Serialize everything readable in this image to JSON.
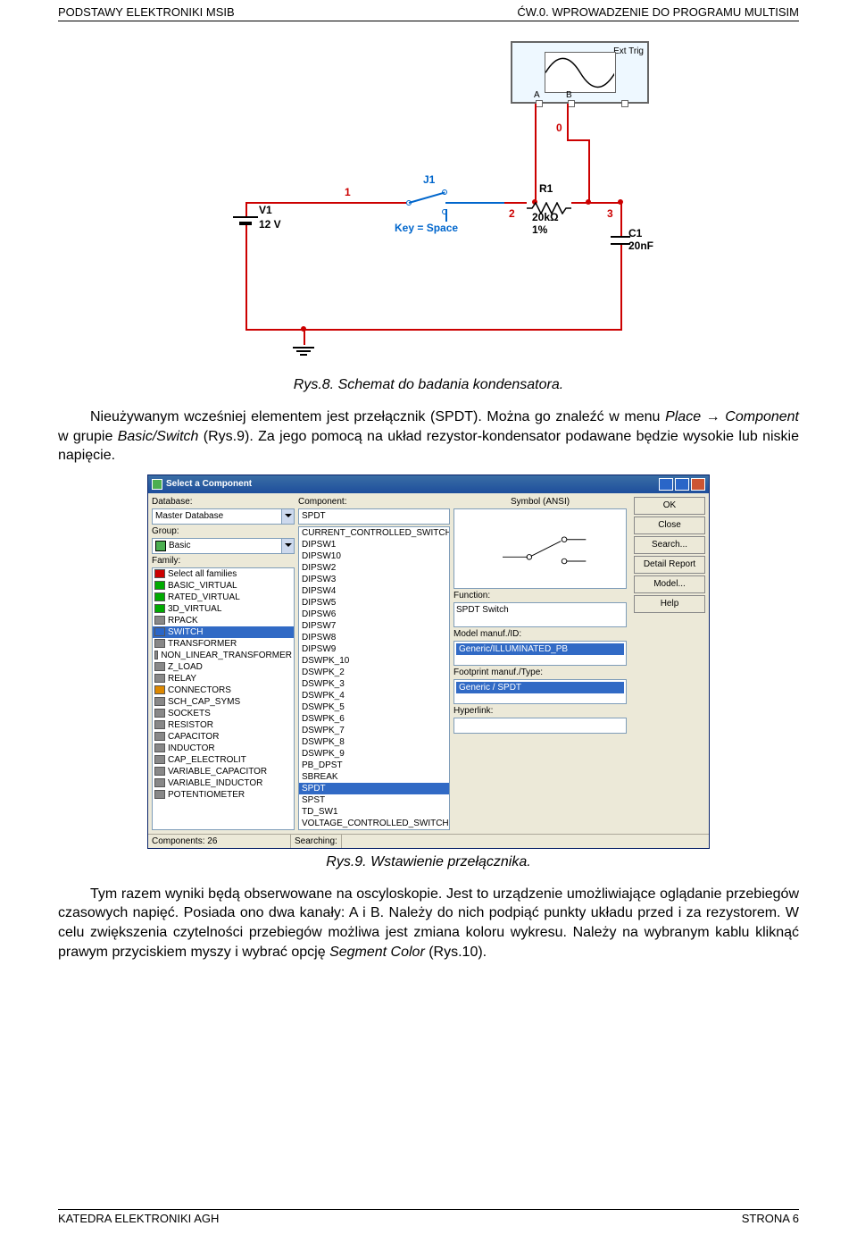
{
  "header": {
    "left": "PODSTAWY ELEKTRONIKI MSIB",
    "right": "ĆW.0. WPROWADZENIE DO PROGRAMU MULTISIM"
  },
  "footer": {
    "left": "KATEDRA ELEKTRONIKI AGH",
    "right": "STRONA 6"
  },
  "schematic": {
    "v1_name": "V1",
    "v1_val": "12 V",
    "j1": "J1",
    "key": "Key = Space",
    "r1_name": "R1",
    "r1_val": "20kΩ",
    "r1_tol": "1%",
    "c1_name": "C1",
    "c1_val": "20nF",
    "net1": "1",
    "net2": "2",
    "net3": "3",
    "net0": "0",
    "scope_A": "A",
    "scope_B": "B",
    "scope_trig": "Ext Trig"
  },
  "caption1": "Rys.8. Schemat do badania kondensatora.",
  "para1_a": "Nieużywanym wcześniej elementem jest przełącznik (SPDT). Można go znaleźć w menu ",
  "para1_i1": "Place → Component",
  "para1_b": " w grupie ",
  "para1_i2": "Basic/Switch",
  "para1_c": " (Rys.9). Za jego pomocą na układ rezystor-kondensator podawane będzie wysokie lub niskie napięcie.",
  "dlg": {
    "title": "Select a Component",
    "database_lbl": "Database:",
    "database_val": "Master Database",
    "group_lbl": "Group:",
    "group_val": "Basic",
    "family_lbl": "Family:",
    "families": [
      {
        "t": "Select all families",
        "c": "red"
      },
      {
        "t": "BASIC_VIRTUAL",
        "c": "green"
      },
      {
        "t": "RATED_VIRTUAL",
        "c": "green"
      },
      {
        "t": "3D_VIRTUAL",
        "c": "green"
      },
      {
        "t": "RPACK",
        "c": ""
      },
      {
        "t": "SWITCH",
        "c": "blue",
        "sel": true
      },
      {
        "t": "TRANSFORMER",
        "c": ""
      },
      {
        "t": "NON_LINEAR_TRANSFORMER",
        "c": ""
      },
      {
        "t": "Z_LOAD",
        "c": ""
      },
      {
        "t": "RELAY",
        "c": ""
      },
      {
        "t": "CONNECTORS",
        "c": "orange"
      },
      {
        "t": "SCH_CAP_SYMS",
        "c": ""
      },
      {
        "t": "SOCKETS",
        "c": ""
      },
      {
        "t": "RESISTOR",
        "c": ""
      },
      {
        "t": "CAPACITOR",
        "c": ""
      },
      {
        "t": "INDUCTOR",
        "c": ""
      },
      {
        "t": "CAP_ELECTROLIT",
        "c": ""
      },
      {
        "t": "VARIABLE_CAPACITOR",
        "c": ""
      },
      {
        "t": "VARIABLE_INDUCTOR",
        "c": ""
      },
      {
        "t": "POTENTIOMETER",
        "c": ""
      }
    ],
    "component_lbl": "Component:",
    "component_val": "SPDT",
    "components": [
      "CURRENT_CONTROLLED_SWITCH",
      "DIPSW1",
      "DIPSW10",
      "DIPSW2",
      "DIPSW3",
      "DIPSW4",
      "DIPSW5",
      "DIPSW6",
      "DIPSW7",
      "DIPSW8",
      "DIPSW9",
      "DSWPK_10",
      "DSWPK_2",
      "DSWPK_3",
      "DSWPK_4",
      "DSWPK_5",
      "DSWPK_6",
      "DSWPK_7",
      "DSWPK_8",
      "DSWPK_9",
      "PB_DPST",
      "SBREAK",
      "SPDT",
      "SPST",
      "TD_SW1",
      "VOLTAGE_CONTROLLED_SWITCH"
    ],
    "components_sel": "SPDT",
    "symbol_lbl": "Symbol (ANSI)",
    "function_lbl": "Function:",
    "function_val": "SPDT Switch",
    "model_lbl": "Model manuf./ID:",
    "model_val": "Generic/ILLUMINATED_PB",
    "footprint_lbl": "Footprint manuf./Type:",
    "footprint_val": "Generic / SPDT",
    "hyperlink_lbl": "Hyperlink:",
    "buttons": [
      "OK",
      "Close",
      "Search...",
      "Detail Report",
      "Model...",
      "Help"
    ],
    "status_components": "Components: 26",
    "status_searching": "Searching:"
  },
  "caption2": "Rys.9. Wstawienie przełącznika.",
  "para2_a": "Tym razem wyniki będą obserwowane na oscyloskopie. Jest to urządzenie umożliwiające oglądanie przebiegów czasowych napięć. Posiada ono dwa kanały: A i B. Należy do nich podpiąć punkty układu przed i za rezystorem. W celu zwiększenia czytelności przebiegów możliwa jest zmiana koloru wykresu. Należy na wybranym kablu kliknąć prawym przyciskiem myszy i wybrać opcję ",
  "para2_i1": "Segment Color",
  "para2_b": " (Rys.10)."
}
